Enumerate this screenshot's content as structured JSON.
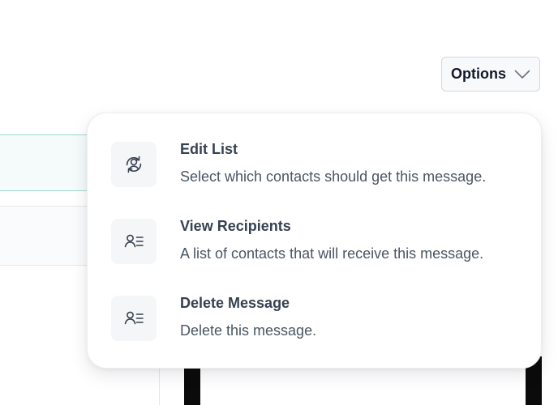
{
  "options_button": {
    "label": "Options",
    "icon": "chevron-down-icon"
  },
  "menu": {
    "items": [
      {
        "title": "Edit List",
        "description": "Select which contacts should get this message.",
        "icon": "user-sync-icon"
      },
      {
        "title": "View Recipients",
        "description": "A list of contacts that will receive this message.",
        "icon": "user-list-icon"
      },
      {
        "title": "Delete Message",
        "description": "Delete this message.",
        "icon": "user-list-icon"
      }
    ]
  },
  "colors": {
    "title_text": "#374151",
    "description_text": "#4b5563",
    "icon_stroke": "#374151",
    "icon_background": "#f5f6f8",
    "button_background": "#f8f9fb"
  }
}
